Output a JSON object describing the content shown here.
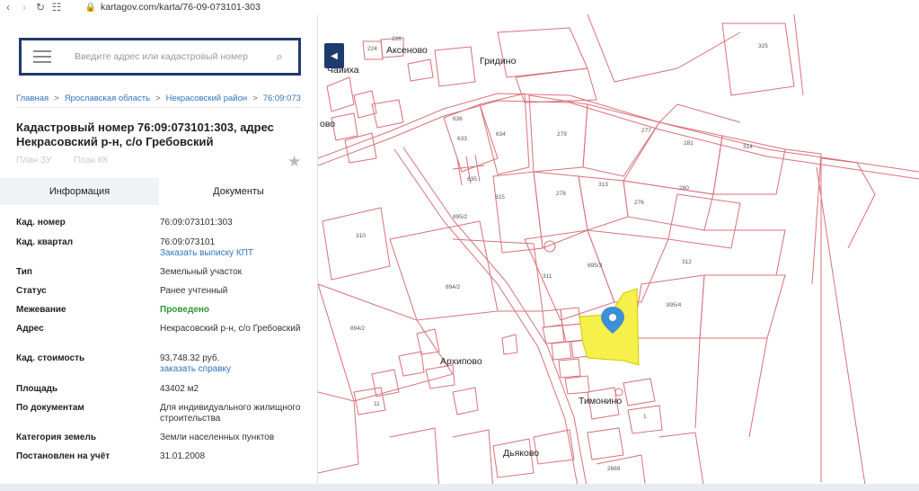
{
  "browser": {
    "url": "kartagov.com/karta/76-09-073101-303",
    "back_icon": "chevron-left-icon",
    "forward_icon": "chevron-right-icon",
    "reload_icon": "reload-icon",
    "apps_icon": "grid-icon",
    "lock_icon": "lock-icon"
  },
  "search": {
    "placeholder": "Введите адрес или кадастровый номер"
  },
  "breadcrumb": [
    "Главная",
    "Ярославская область",
    "Некрасовский район",
    "76:09:073"
  ],
  "title": "Кадастровый номер 76:09:073101:303, адрес Некрасовский р-н, с/о Гребовский",
  "plan_links": [
    "План ЗУ",
    "План КК"
  ],
  "tabs": [
    {
      "label": "Информация",
      "active": false
    },
    {
      "label": "Документы",
      "active": true
    }
  ],
  "properties": [
    {
      "key": "Кад. номер",
      "value": "76:09:073101:303"
    },
    {
      "key": "Кад. квартал",
      "value": "76:09:073101",
      "link": "Заказать выписку КПТ"
    },
    {
      "key": "Тип",
      "value": "Земельный участок"
    },
    {
      "key": "Статус",
      "value": "Ранее учтенный"
    },
    {
      "key": "Межевание",
      "value": "Проведено"
    },
    {
      "key": "Адрес",
      "value": "Некрасовский р-н, с/о Гребовский"
    },
    {
      "key": "Кад. стоимость",
      "value": "93,748.32 руб.",
      "link": "заказать справку"
    },
    {
      "key": "Площадь",
      "value": "43402 м2"
    },
    {
      "key": "По документам",
      "value": "Для индивидуального жилищного строительства"
    },
    {
      "key": "Категория земель",
      "value": "Земли населенных пунктов"
    },
    {
      "key": "Постановлен на учёт",
      "value": "31.01.2008"
    }
  ],
  "map": {
    "places": [
      "Аксеново",
      "Гридино",
      "Архипово",
      "Тимонино",
      "Дьяково",
      "Чайиха",
      "ово"
    ],
    "parcels": [
      "224",
      "226",
      "325",
      "636",
      "633",
      "634",
      "279",
      "277",
      "281",
      "314",
      "635",
      "315",
      "278",
      "276",
      "280",
      "313",
      "895/2",
      "310",
      "895/3",
      "312",
      "311",
      "894/2",
      "895/4",
      "894/2",
      "1",
      "2669",
      "11"
    ],
    "highlight_color": "#f5f04a",
    "line_color": "#d9707a",
    "marker_color": "#3d8fd6",
    "marker_icon": "map-pin-icon"
  }
}
